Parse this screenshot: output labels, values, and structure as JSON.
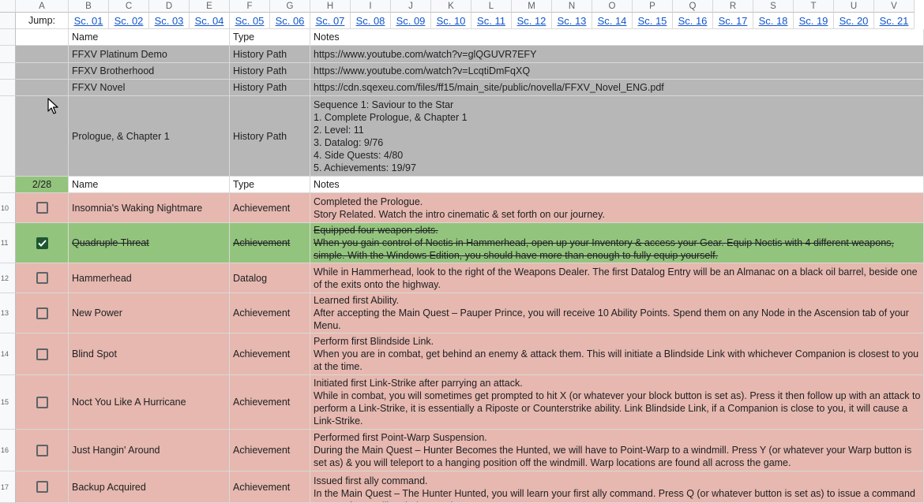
{
  "column_headers": [
    "A",
    "B",
    "C",
    "D",
    "E",
    "F",
    "G",
    "H",
    "I",
    "J",
    "K",
    "L",
    "M",
    "N",
    "O",
    "P",
    "Q",
    "R",
    "S",
    "T",
    "U",
    "V"
  ],
  "jump": {
    "label": "Jump:",
    "links": [
      "Sc. 01",
      "Sc. 02",
      "Sc. 03",
      "Sc. 04",
      "Sc. 05",
      "Sc. 06",
      "Sc. 07",
      "Sc. 08",
      "Sc. 09",
      "Sc. 10",
      "Sc. 11",
      "Sc. 12",
      "Sc. 13",
      "Sc. 14",
      "Sc. 15",
      "Sc. 16",
      "Sc. 17",
      "Sc. 18",
      "Sc. 19",
      "Sc. 20",
      "Sc. 21"
    ]
  },
  "headers": {
    "name": "Name",
    "type": "Type",
    "notes": "Notes"
  },
  "section_progress": "2/28",
  "history_rows": [
    {
      "name": "FFXV Platinum Demo",
      "type": "History Path",
      "notes": "https://www.youtube.com/watch?v=glQGUVR7EFY"
    },
    {
      "name": "FFXV Brotherhood",
      "type": "History Path",
      "notes": "https://www.youtube.com/watch?v=LcqtiDmFqXQ"
    },
    {
      "name": "FFXV Novel",
      "type": "History Path",
      "notes": "https://cdn.sqexeu.com/files/ff15/main_site/public/novella/FFXV_Novel_ENG.pdf"
    },
    {
      "name": "Prologue, & Chapter 1",
      "type": "History Path",
      "notes": "Sequence 1: Saviour to the Star\n1. Complete Prologue, & Chapter 1\n2. Level: 11\n3. Datalog: 9/76\n4. Side Quests: 4/80\n5. Achievements: 19/97"
    }
  ],
  "task_rows": [
    {
      "row": "10",
      "checked": false,
      "name": "Insomnia's Waking Nightmare",
      "type": "Achievement",
      "notes": "Completed the Prologue.\nStory Related. Watch the intro cinematic & set forth on our journey."
    },
    {
      "row": "11",
      "checked": true,
      "name": "Quadruple Threat",
      "type": "Achievement",
      "notes": "Equipped four weapon slots.\nWhen you gain control of Noctis in Hammerhead, open up your Inventory & access your Gear. Equip Noctis with 4 different weapons, simple. With the Windows Edition, you should have more than enough to fully equip yourself."
    },
    {
      "row": "12",
      "checked": false,
      "name": "Hammerhead",
      "type": "Datalog",
      "notes": "While in Hammerhead, look to the right of the Weapons Dealer. The first Datalog Entry will be an Almanac on a black oil barrel, beside one of the exits onto the highway."
    },
    {
      "row": "13",
      "checked": false,
      "name": "New Power",
      "type": "Achievement",
      "notes": "Learned first Ability.\nAfter accepting the Main Quest – Pauper Prince, you will receive 10 Ability Points. Spend them on any Node in the Ascension tab of your Menu."
    },
    {
      "row": "14",
      "checked": false,
      "name": "Blind Spot",
      "type": "Achievement",
      "notes": "Perform first Blindside Link.\nWhen you are in combat, get behind an enemy & attack them. This will initiate a Blindside Link with whichever Companion is closest to you at the time."
    },
    {
      "row": "15",
      "checked": false,
      "name": "Noct You Like A Hurricane",
      "type": "Achievement",
      "notes": "Initiated first Link-Strike after parrying an attack.\nWhile in combat, you will sometimes get prompted to hit X (or whatever your block button is set as). Press it then follow up with an attack to perform a Link-Strike, it is essentially a Riposte or Counterstrike ability. Link Blindside Link, if a Companion is close to you, it will cause a Link-Strike."
    },
    {
      "row": "16",
      "checked": false,
      "name": "Just Hangin' Around",
      "type": "Achievement",
      "notes": "Performed first Point-Warp Suspension.\nDuring the Main Quest – Hunter Becomes the Hunted, we will have to Point-Warp to a windmill. Press Y (or whatever your Warp button is set as) & you will teleport to a hanging position off the windmill. Warp locations are found all across the game."
    },
    {
      "row": "17",
      "checked": false,
      "name": "Backup Acquired",
      "type": "Achievement",
      "notes": "Issued first ally command.\nIn the Main Quest – The Hunter Hunted, you will learn your first ally command. Press Q (or whatever button is set as) to issue a command to one of your allies during combat."
    }
  ],
  "colors": {
    "gray_section": "#b7b7b7",
    "incomplete": "#e6b8af",
    "complete": "#93c47d",
    "link": "#1155cc",
    "check_fill": "#1e5631"
  }
}
